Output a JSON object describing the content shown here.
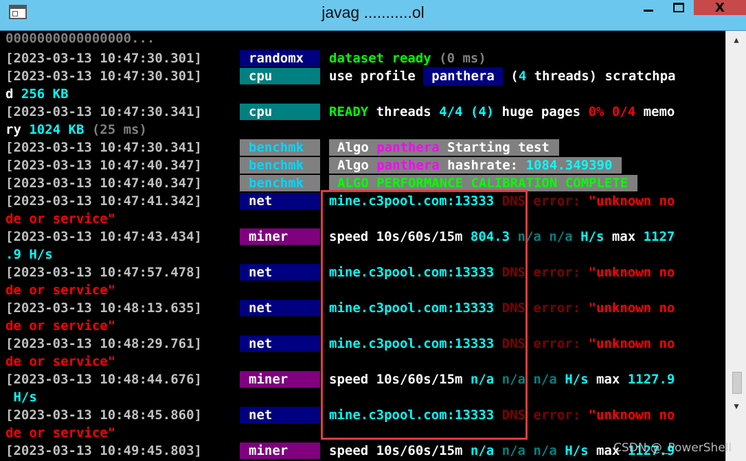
{
  "window": {
    "title": "javag ...........ol",
    "controls": {
      "minimize": "—",
      "maximize": "□",
      "close": "X"
    }
  },
  "console": {
    "partial_top": "0000000000000000...",
    "lines": [
      {
        "ts": "[2023-03-13 10:47:30.301]",
        "tag": "randomx",
        "seg1": "dataset ready",
        "seg2": " (0 ms)"
      },
      {
        "ts": "[2023-03-13 10:47:30.301]",
        "tag": "cpu",
        "seg1": "use profile ",
        "seg2": "panthera",
        "seg3": " (",
        "seg4": "4",
        "seg5": " threads) scratchpa"
      },
      {
        "cont1": "d ",
        "cont2": "256 KB"
      },
      {
        "ts": "[2023-03-13 10:47:30.341]",
        "tag": "cpu",
        "seg1": "READY",
        "seg2": " threads ",
        "seg3": "4/4 (4)",
        "seg4": " huge pages ",
        "seg5": "0% 0/4",
        "seg6": " memo"
      },
      {
        "cont1": "ry ",
        "cont2": "1024 KB",
        "cont3": " (25 ms)"
      },
      {
        "ts": "[2023-03-13 10:47:30.341]",
        "tag": "benchmk",
        "seg1": "Algo ",
        "seg2": "panthera",
        "seg3": " Starting test"
      },
      {
        "ts": "[2023-03-13 10:47:40.347]",
        "tag": "benchmk",
        "seg1": "Algo ",
        "seg2": "panthera",
        "seg3": " hashrate: ",
        "seg4": "1084.349390"
      },
      {
        "ts": "[2023-03-13 10:47:40.347]",
        "tag": "benchmk",
        "seg1": "ALGO PERFORMANCE CALIBRATION COMPLETE"
      },
      {
        "ts": "[2023-03-13 10:47:41.342]",
        "tag": "net",
        "seg1": "mine.c3pool.com:13333",
        "seg2": " DNS error: ",
        "seg3": "\"unknown no"
      },
      {
        "cont1": "de or service\""
      },
      {
        "ts": "[2023-03-13 10:47:43.434]",
        "tag": "miner",
        "seg1": "speed 10s/60s/15m ",
        "seg2": "804.3",
        "seg3": " n/a n/a ",
        "seg4": "H/s",
        "seg5": " max ",
        "seg6": "1127"
      },
      {
        "cont1": ".9 H/s"
      },
      {
        "ts": "[2023-03-13 10:47:57.478]",
        "tag": "net",
        "seg1": "mine.c3pool.com:13333",
        "seg2": " DNS error: ",
        "seg3": "\"unknown no"
      },
      {
        "cont1": "de or service\""
      },
      {
        "ts": "[2023-03-13 10:48:13.635]",
        "tag": "net",
        "seg1": "mine.c3pool.com:13333",
        "seg2": " DNS error: ",
        "seg3": "\"unknown no"
      },
      {
        "cont1": "de or service\""
      },
      {
        "ts": "[2023-03-13 10:48:29.761]",
        "tag": "net",
        "seg1": "mine.c3pool.com:13333",
        "seg2": " DNS error: ",
        "seg3": "\"unknown no"
      },
      {
        "cont1": "de or service\""
      },
      {
        "ts": "[2023-03-13 10:48:44.676]",
        "tag": "miner",
        "seg1": "speed 10s/60s/15m ",
        "seg2": "n/a",
        "seg3": " n/a n/a ",
        "seg4": "H/s",
        "seg5": " max ",
        "seg6": "1127.9"
      },
      {
        "cont1": " H/s"
      },
      {
        "ts": "[2023-03-13 10:48:45.860]",
        "tag": "net",
        "seg1": "mine.c3pool.com:13333",
        "seg2": " DNS error: ",
        "seg3": "\"unknown no"
      },
      {
        "cont1": "de or service\""
      },
      {
        "ts": "[2023-03-13 10:49:45.803]",
        "tag": "miner",
        "seg1": "speed 10s/60s/15m ",
        "seg2": "n/a",
        "seg3": " n/a n/a ",
        "seg4": "H/s",
        "seg5": " max ",
        "seg6": "1127.9"
      }
    ]
  },
  "watermark": "CSDN @_PowerShell",
  "colors": {
    "titlebar": "#6cc7ee",
    "highlight_box": "#e23b3b",
    "close_button": "#c7494a"
  }
}
